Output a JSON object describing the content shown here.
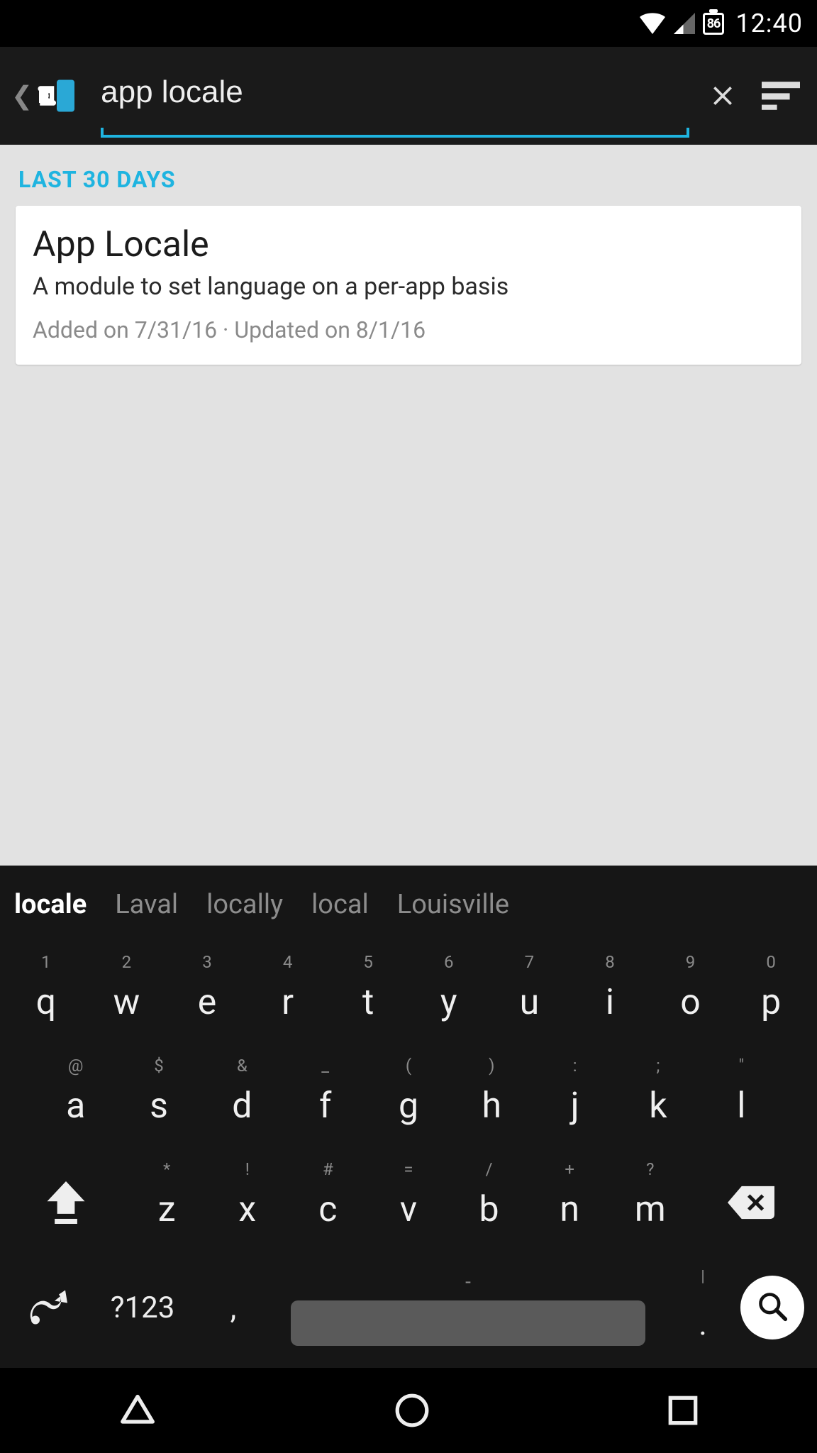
{
  "status": {
    "battery_percent": "86",
    "time": "12:40"
  },
  "search": {
    "value": "app locale"
  },
  "section_header": "LAST 30 DAYS",
  "result": {
    "title": "App Locale",
    "description": "A module to set language on a per-app basis",
    "meta": "Added on 7/31/16 · Updated on 8/1/16"
  },
  "suggestions": [
    "locale",
    "Laval",
    "locally",
    "local",
    "Louisville"
  ],
  "keyboard": {
    "row1": [
      {
        "k": "q",
        "h": "1"
      },
      {
        "k": "w",
        "h": "2"
      },
      {
        "k": "e",
        "h": "3"
      },
      {
        "k": "r",
        "h": "4"
      },
      {
        "k": "t",
        "h": "5"
      },
      {
        "k": "y",
        "h": "6"
      },
      {
        "k": "u",
        "h": "7"
      },
      {
        "k": "i",
        "h": "8"
      },
      {
        "k": "o",
        "h": "9"
      },
      {
        "k": "p",
        "h": "0"
      }
    ],
    "row2": [
      {
        "k": "a",
        "h": "@"
      },
      {
        "k": "s",
        "h": "$"
      },
      {
        "k": "d",
        "h": "&"
      },
      {
        "k": "f",
        "h": "_"
      },
      {
        "k": "g",
        "h": "("
      },
      {
        "k": "h",
        "h": ")"
      },
      {
        "k": "j",
        "h": ":"
      },
      {
        "k": "k",
        "h": ";"
      },
      {
        "k": "l",
        "h": "\""
      }
    ],
    "row3": [
      {
        "k": "z",
        "h": "*"
      },
      {
        "k": "x",
        "h": "!"
      },
      {
        "k": "c",
        "h": "#"
      },
      {
        "k": "v",
        "h": "="
      },
      {
        "k": "b",
        "h": "/"
      },
      {
        "k": "n",
        "h": "+"
      },
      {
        "k": "m",
        "h": "?"
      }
    ],
    "sym_label": "?123",
    "space_hint": "-",
    "dot_hint": "|"
  }
}
